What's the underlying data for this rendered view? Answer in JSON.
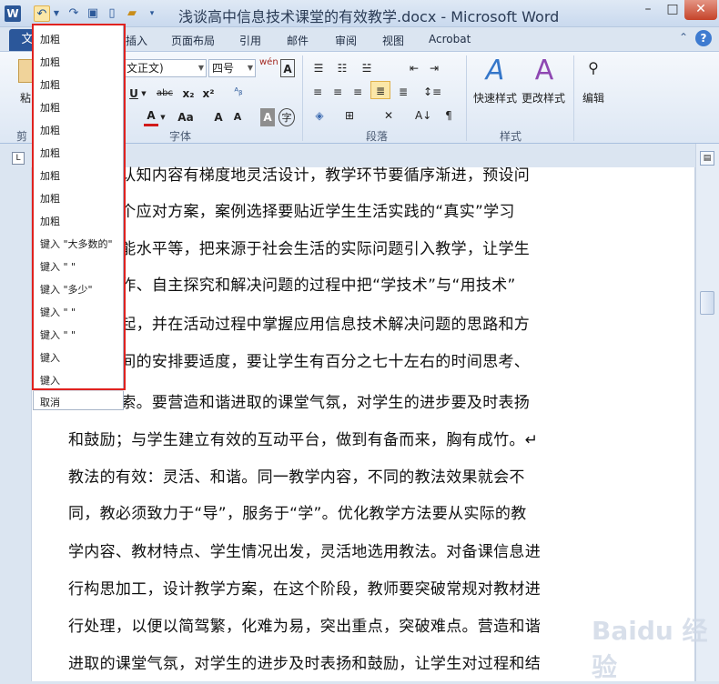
{
  "window": {
    "title": "浅谈高中信息技术课堂的有效教学.docx - Microsoft Word",
    "app_icon": "W",
    "minimize": "–",
    "maximize": "□",
    "close": "✕"
  },
  "tabs": {
    "file": "文",
    "insert": "插入",
    "page_layout": "页面布局",
    "references": "引用",
    "mailings": "邮件",
    "review": "审阅",
    "view": "视图",
    "acrobat": "Acrobat"
  },
  "ribbon": {
    "clipboard_label": "剪",
    "paste_label": "粘",
    "font_name": "文正文)",
    "font_size": "四号",
    "wen_glyph": "wén\n变",
    "font_group_label": "字体",
    "paragraph_group_label": "段落",
    "styles_group_label": "样式",
    "quick_styles": "快速样式",
    "change_styles": "更改样式",
    "editing": "编辑",
    "underline": "U",
    "strike": "abc",
    "subscript": "x₂",
    "superscript": "x²",
    "font_color": "A",
    "change_case": "Aa",
    "grow_font": "A",
    "shrink_font": "A",
    "char_shading": "A",
    "enclose_char": "字"
  },
  "undo_menu": {
    "items": [
      "加粗",
      "加粗",
      "加粗",
      "加粗",
      "加粗",
      "加粗",
      "加粗",
      "加粗",
      "加粗",
      "键入 \"大多数的\"",
      "键入 \" \"",
      "键入 \"多少\"",
      "键入 \"  \"",
      "键入 \"    \"",
      "键入",
      "键入"
    ],
    "cancel": "取消"
  },
  "document": {
    "lines": [
      "和认知内容有梯度地灵活设计，教学环节要循序渐进，预设问",
      "多个应对方案，案例选择要贴近学生生活实践的“真实”学习",
      "技能水平等，把来源于社会生活的实际问题引入教学，让学生",
      "操作、自主探究和解决问题的过程中把“学技术”与“用技术”",
      "一起，并在活动过程中掌握应用信息技术解决问题的思路和方",
      "时间的安排要适度，要让学生有百分之七十左右的时间思考、",
      "探索。要营造和谐进取的课堂气氛，对学生的进步要及时表扬",
      "和鼓励；与学生建立有效的互动平台，做到有备而来，胸有成竹。↵",
      "  教法的有效：灵活、和谐。同一教学内容，不同的教法效果就会不",
      "同，教必须致力于“导”，服务于“学”。优化教学方法要从实际的教",
      "学内容、教材特点、学生情况出发，灵活地选用教法。对备课信息进",
      "行构思加工，设计教学方案，在这个阶段，教师要突破常规对教材进",
      "行处理，以便以简驾繁，化难为易，突出重点，突破难点。营造和谐",
      "进取的课堂气氛，对学生的进步及时表扬和鼓励，让学生对过程和结"
    ]
  },
  "watermark": "Baidu 经验"
}
